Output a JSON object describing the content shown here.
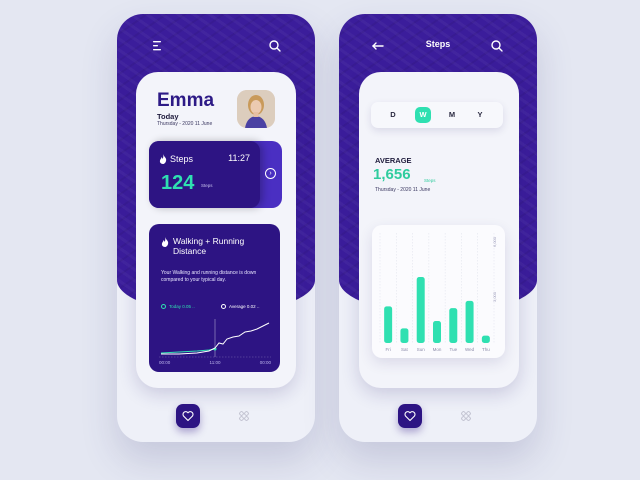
{
  "left": {
    "profile": {
      "name": "Emma",
      "today_label": "Today",
      "date": "Thursday - 2020 11 June"
    },
    "steps_card": {
      "label": "Steps",
      "time": "11:27",
      "value": "124",
      "unit": "Steps"
    },
    "walk_card": {
      "title": "Walking + Running Distance",
      "description": "Your Walking and running distance is down compared to your typical day.",
      "legend_today": "Today 0.05 ..",
      "legend_average": "Average 0.02 ..",
      "x_ticks": [
        "00:00",
        "11:00",
        "00:00"
      ]
    }
  },
  "right": {
    "header_title": "Steps",
    "period_tabs": [
      "D",
      "W",
      "M",
      "Y"
    ],
    "active_tab": "W",
    "average_label": "AVERAGE",
    "average_value": "1,656",
    "average_unit": "Steps",
    "average_date": "Thursday - 2020 11 June"
  },
  "colors": {
    "primary": "#2d1483",
    "accent": "#2fe0b1",
    "background": "#e4e7f2"
  },
  "chart_data": {
    "type": "bar",
    "categories": [
      "Fri",
      "Sat",
      "Sun",
      "Mon",
      "Tue",
      "Wed",
      "Thu"
    ],
    "values": [
      2000,
      800,
      3600,
      1200,
      1900,
      2300,
      400
    ],
    "y_ticks": [
      "3,000",
      "6,000"
    ],
    "ylim": [
      0,
      6000
    ],
    "grid": true
  }
}
